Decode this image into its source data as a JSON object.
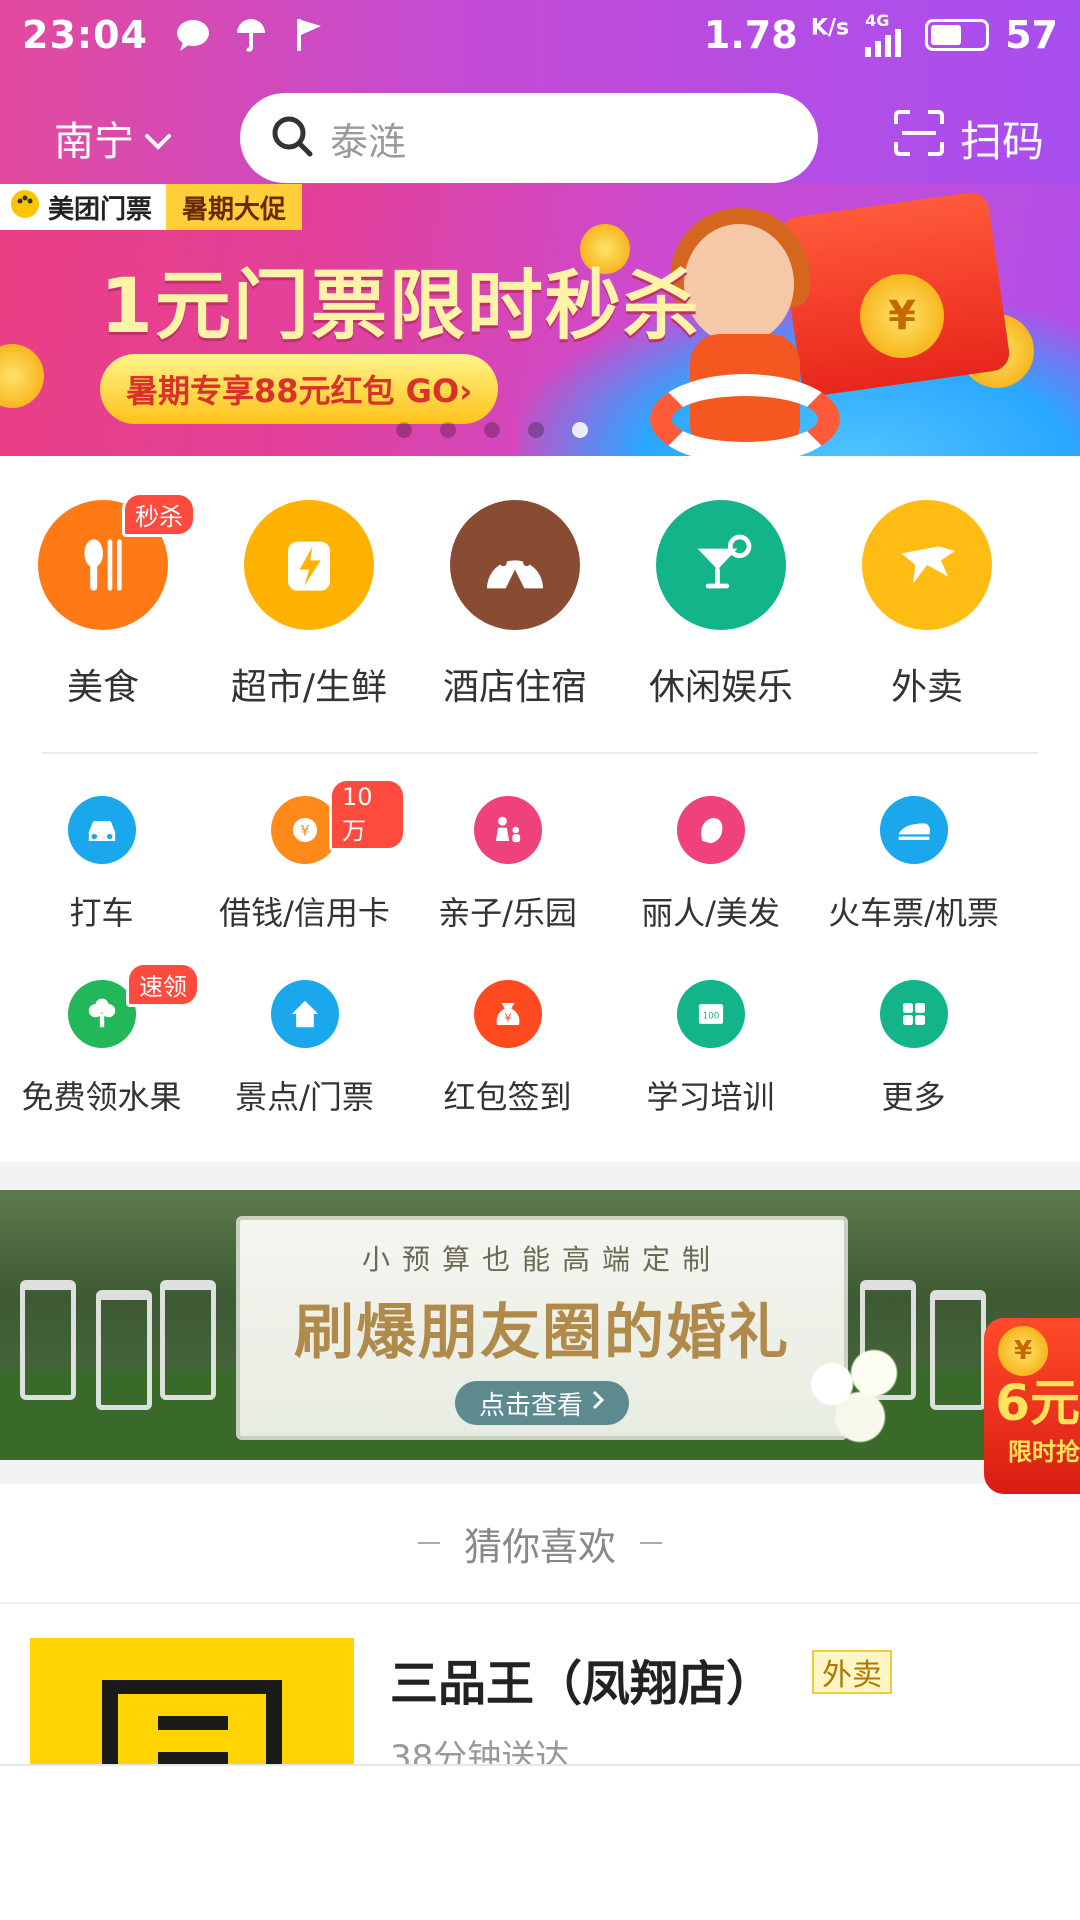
{
  "status_bar": {
    "time": "23:04",
    "speed_value": "1.78",
    "speed_unit": "K/s",
    "network": "4G",
    "battery": "57"
  },
  "topbar": {
    "city": "南宁",
    "search_placeholder": "泰涟",
    "scan_label": "扫码"
  },
  "banner": {
    "brand_tag": "美团门票",
    "sale_tag": "暑期大促",
    "title": "1元门票限时秒杀",
    "button": "暑期专享88元红包 GO›",
    "coin_symbol": "¥",
    "dot_count": 5,
    "active_dot": 4
  },
  "categories": [
    {
      "label": "美食",
      "icon": "fork-spoon-icon",
      "color": "#ff7a14",
      "badge": "秒杀"
    },
    {
      "label": "超市/生鲜",
      "icon": "lightning-bag-icon",
      "color": "#ffb300",
      "badge": ""
    },
    {
      "label": "酒店住宿",
      "icon": "hotel-tent-icon",
      "color": "#8a4b33",
      "badge": ""
    },
    {
      "label": "休闲娱乐",
      "icon": "cocktail-icon",
      "color": "#14b48a",
      "badge": ""
    },
    {
      "label": "外卖",
      "icon": "kangaroo-icon",
      "color": "#ffbc12",
      "badge": ""
    }
  ],
  "services_row1": [
    {
      "label": "打车",
      "icon": "car-icon",
      "color": "#1aa7ec",
      "badge": ""
    },
    {
      "label": "借钱/信用卡",
      "icon": "coin-icon",
      "color": "#ff8a1a",
      "badge": "10万"
    },
    {
      "label": "亲子/乐园",
      "icon": "parent-child-icon",
      "color": "#f0427a",
      "badge": ""
    },
    {
      "label": "丽人/美发",
      "icon": "woman-hair-icon",
      "color": "#f0427a",
      "badge": ""
    },
    {
      "label": "火车票/机票",
      "icon": "train-icon",
      "color": "#1aa7ec",
      "badge": ""
    }
  ],
  "services_row2": [
    {
      "label": "免费领水果",
      "icon": "fruit-tree-icon",
      "color": "#22b85a",
      "badge": "速领"
    },
    {
      "label": "景点/门票",
      "icon": "scenic-house-icon",
      "color": "#1aa7ec",
      "badge": ""
    },
    {
      "label": "红包签到",
      "icon": "money-bag-icon",
      "color": "#ff4a20",
      "badge": ""
    },
    {
      "label": "学习培训",
      "icon": "certificate-icon",
      "color": "#14b48a",
      "badge": ""
    },
    {
      "label": "更多",
      "icon": "grid-more-icon",
      "color": "#14b48a",
      "badge": ""
    }
  ],
  "wedding_banner": {
    "subtitle": "小预算也能高端定制",
    "title": "刷爆朋友圈的婚礼",
    "button": "点击查看"
  },
  "promo_float": {
    "coin_symbol": "¥",
    "amount": "6元",
    "sub": "限时抢"
  },
  "recommend": {
    "heading": "猜你喜欢"
  },
  "listing": {
    "name": "三品王（凤翔店）",
    "tag": "外卖",
    "delivery": "38分钟送达"
  }
}
